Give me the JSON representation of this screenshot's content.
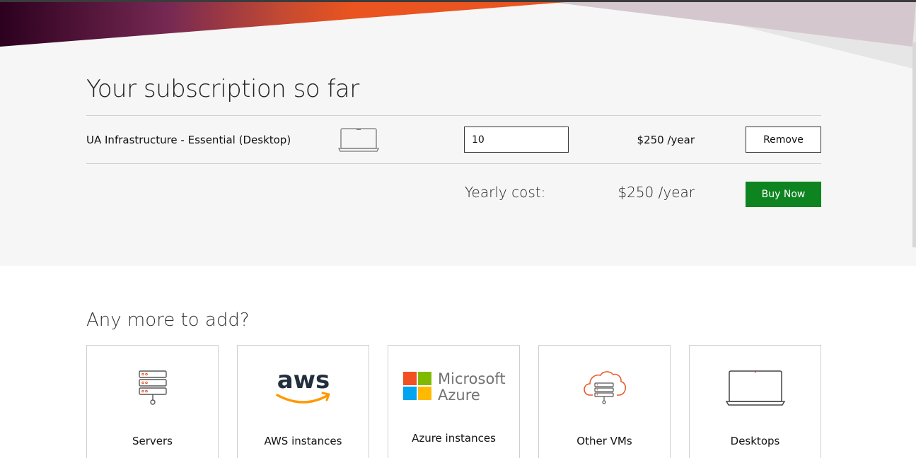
{
  "subscription": {
    "title": "Your subscription so far",
    "item": {
      "name": "UA Infrastructure - Essential (Desktop)",
      "quantity": "10",
      "price": "$250 /year",
      "remove_label": "Remove",
      "icon": "laptop-icon"
    },
    "yearly_label": "Yearly cost:",
    "yearly_value": "$250 /year",
    "buy_label": "Buy Now"
  },
  "more": {
    "title": "Any more to add?",
    "cards": [
      {
        "label": "Servers",
        "icon": "server-icon"
      },
      {
        "label": "AWS instances",
        "icon": "aws-logo"
      },
      {
        "label": "Azure instances",
        "icon": "azure-logo"
      },
      {
        "label": "Other VMs",
        "icon": "cloud-server-icon"
      },
      {
        "label": "Desktops",
        "icon": "laptop-icon"
      }
    ]
  },
  "logos": {
    "aws_text": "aws",
    "azure_line1": "Microsoft",
    "azure_line2": "Azure"
  },
  "colors": {
    "accent": "#e95420",
    "buy_button": "#0e8420",
    "aubergine": "#2c001e"
  }
}
